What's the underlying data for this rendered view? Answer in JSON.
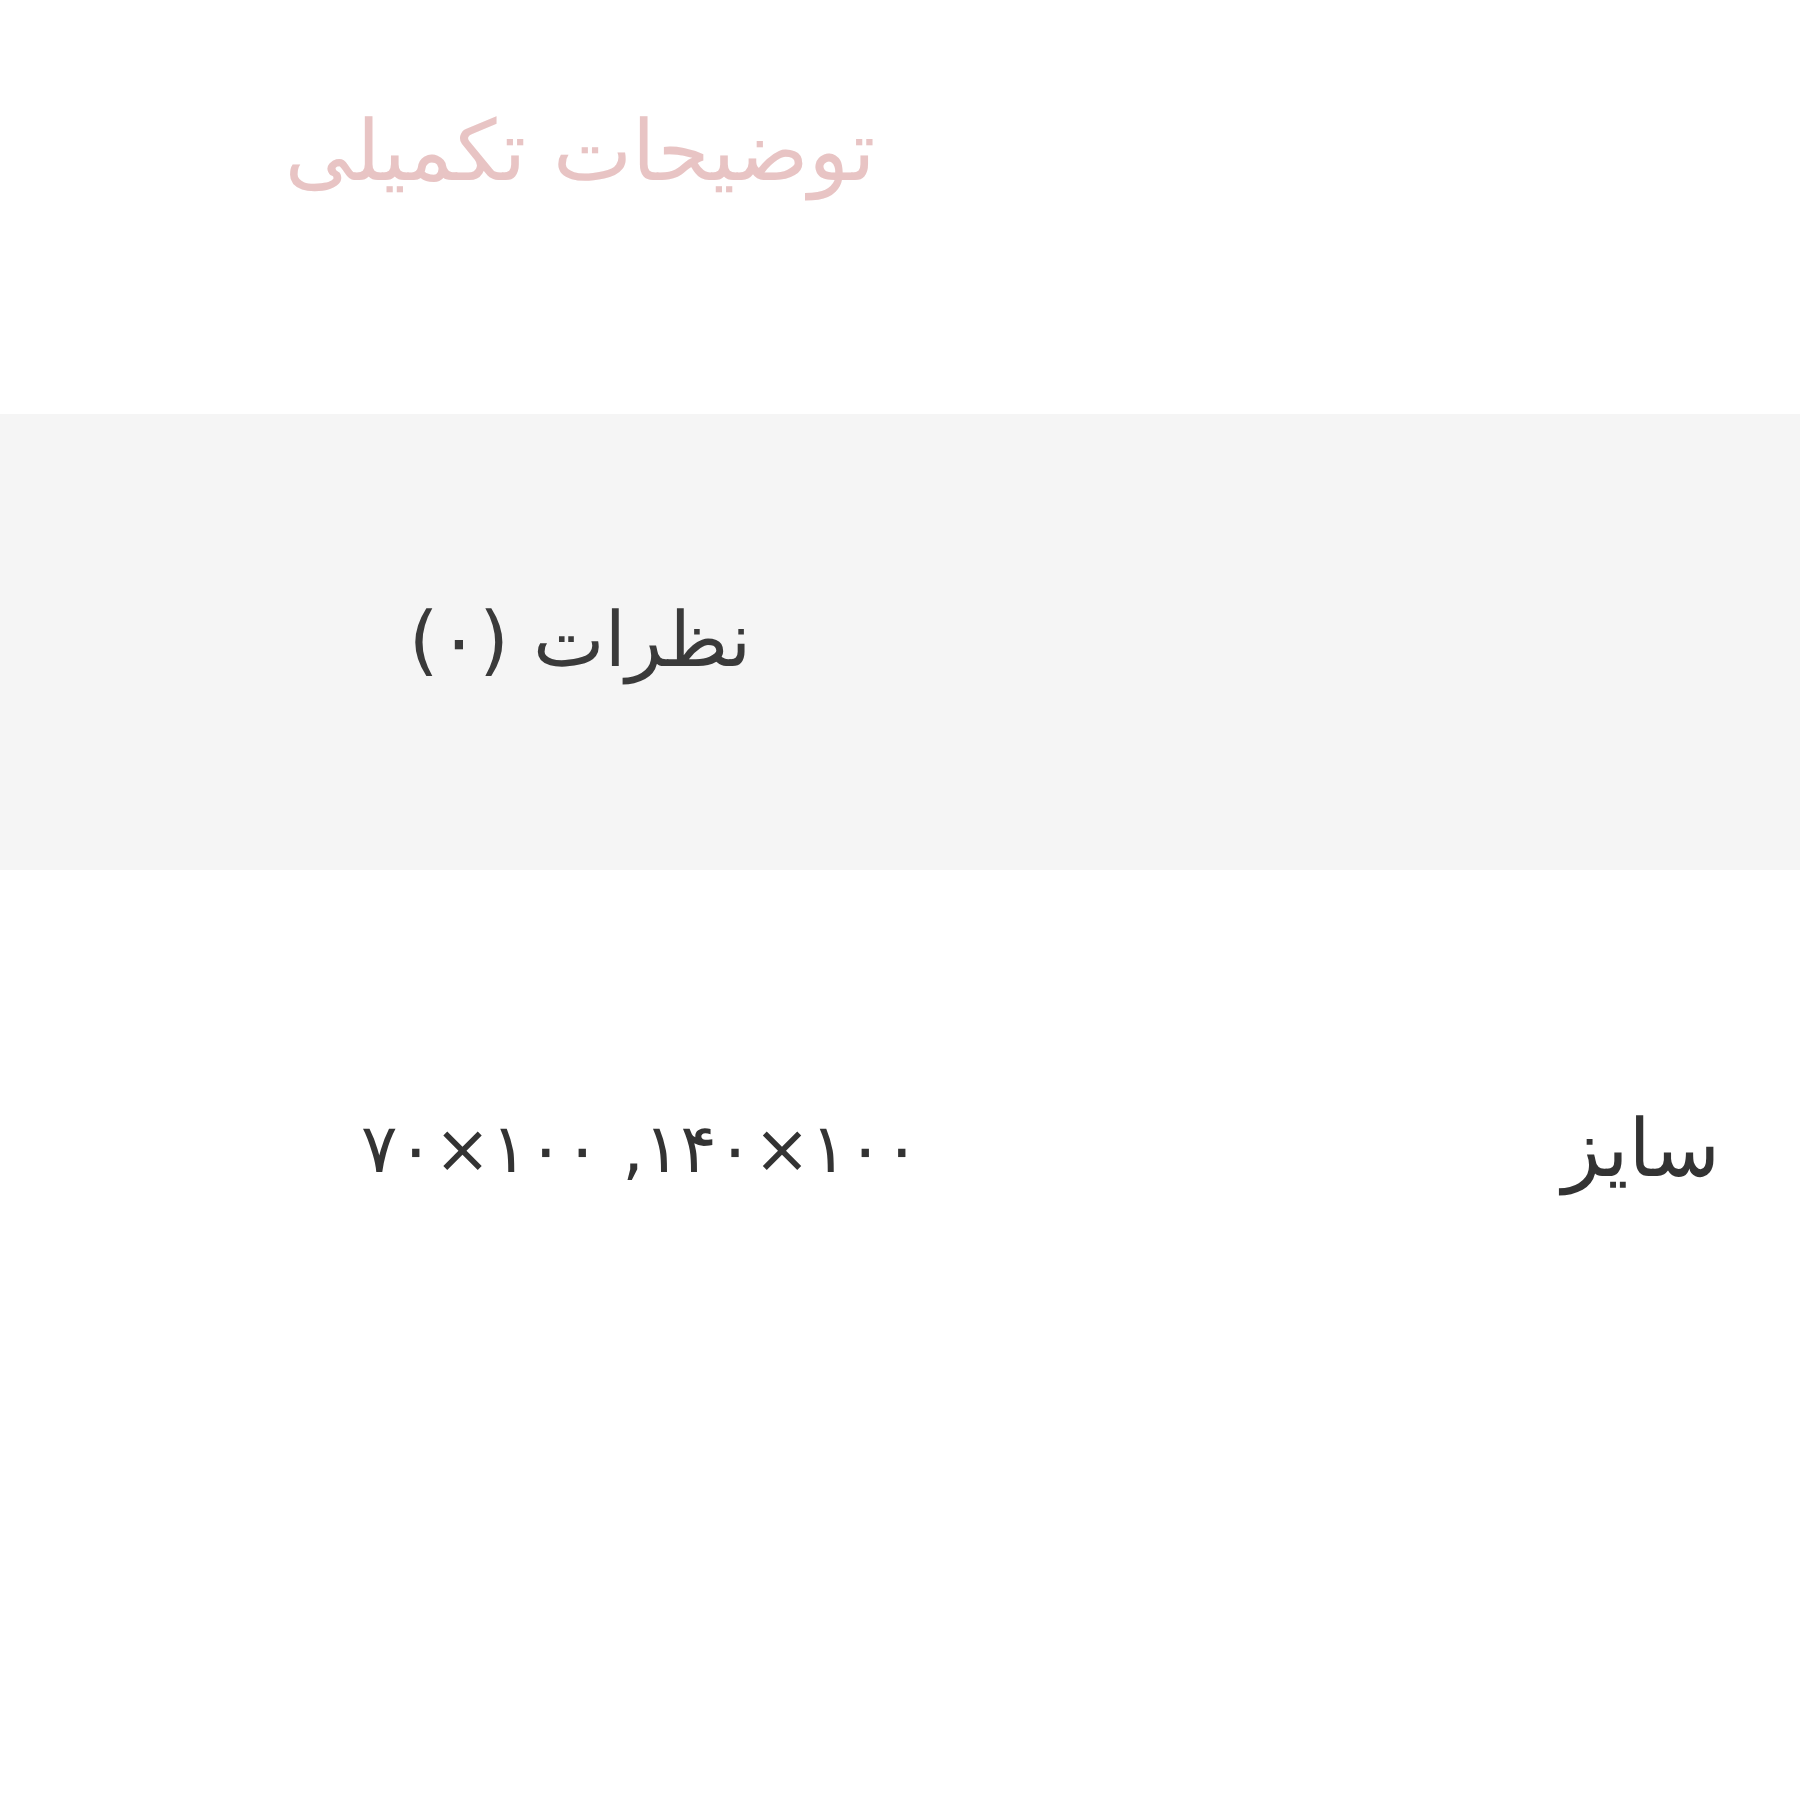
{
  "tabs": [
    {
      "label": "توضیحات تکمیلی",
      "selected": true
    },
    {
      "label": "نظرات (۰)",
      "selected": false
    }
  ],
  "attributes": [
    {
      "label": "سایز",
      "value": "۱۰۰×۱۴۰, ۱۰۰×۷۰"
    }
  ]
}
